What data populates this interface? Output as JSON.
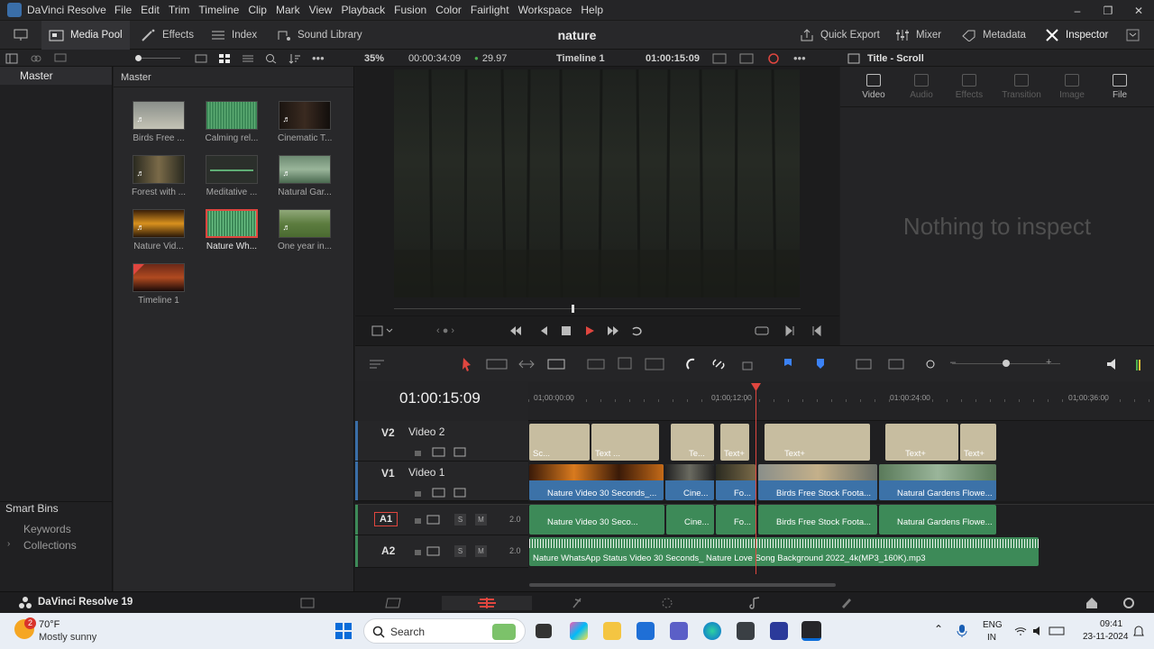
{
  "app": {
    "title": "DaVinci Resolve",
    "menu": [
      "File",
      "Edit",
      "Trim",
      "Timeline",
      "Clip",
      "Mark",
      "View",
      "Playback",
      "Fusion",
      "Color",
      "Fairlight",
      "Workspace",
      "Help"
    ],
    "window_controls": [
      "–",
      "❐",
      "✕"
    ]
  },
  "toolbar": {
    "media_pool": "Media Pool",
    "effects": "Effects",
    "index": "Index",
    "sound_library": "Sound Library",
    "project_name": "nature",
    "quick_export": "Quick Export",
    "mixer": "Mixer",
    "metadata": "Metadata",
    "inspector": "Inspector"
  },
  "viewer_bar": {
    "zoom": "35%",
    "duration": "00:00:34:09",
    "fps": "29.97",
    "timeline_name": "Timeline 1",
    "timecode": "01:00:15:09",
    "inspector_title": "Title - Scroll"
  },
  "bins": {
    "master": "Master",
    "smart_bins": "Smart Bins",
    "keywords": "Keywords",
    "collections": "Collections"
  },
  "media_pool": {
    "header": "Master",
    "clips": [
      {
        "label": "Birds Free ...",
        "kind": "video",
        "selected": false
      },
      {
        "label": "Calming rel...",
        "kind": "audio",
        "selected": false
      },
      {
        "label": "Cinematic T...",
        "kind": "video",
        "selected": false
      },
      {
        "label": "Forest with ...",
        "kind": "video",
        "selected": false
      },
      {
        "label": "Meditative ...",
        "kind": "audio",
        "selected": false
      },
      {
        "label": "Natural Gar...",
        "kind": "video",
        "selected": false
      },
      {
        "label": "Nature Vid...",
        "kind": "video",
        "selected": false
      },
      {
        "label": "Nature Wh...",
        "kind": "audio",
        "selected": true
      },
      {
        "label": "One year in...",
        "kind": "video",
        "selected": false
      },
      {
        "label": "Timeline 1",
        "kind": "timeline",
        "selected": false
      }
    ]
  },
  "inspector": {
    "tabs": [
      "Video",
      "Audio",
      "Effects",
      "Transition",
      "Image",
      "File"
    ],
    "empty_message": "Nothing to inspect"
  },
  "timeline": {
    "timecode": "01:00:15:09",
    "ruler": [
      "01:00:00:00",
      "01:00:12:00",
      "01:00:24:00",
      "01:00:36:00"
    ],
    "tracks": {
      "v2": {
        "id": "V2",
        "name": "Video 2"
      },
      "v1": {
        "id": "V1",
        "name": "Video 1"
      },
      "a1": {
        "id": "A1",
        "level": "2.0",
        "s": "S",
        "m": "M"
      },
      "a2": {
        "id": "A2",
        "level": "2.0",
        "s": "S",
        "m": "M"
      }
    },
    "v2_clips": [
      "Sc...",
      "Text ...",
      "Te...",
      "Text+",
      "Text+",
      "Text+",
      "Text+"
    ],
    "v1_clips": [
      "Nature Video 30 Seconds_...",
      "Cine...",
      "Fo...",
      "Birds Free Stock Foota...",
      "Natural Gardens Flowe..."
    ],
    "a1_clips": [
      "Nature Video 30 Seco...",
      "Cine...",
      "Fo...",
      "Birds Free Stock Foota...",
      "Natural Gardens Flowe..."
    ],
    "a2_clip": "Nature WhatsApp Status Video 30 Seconds_ Nature Love Song Background 2022_4k(MP3_160K).mp3"
  },
  "pagebar": {
    "brand": "DaVinci Resolve 19"
  },
  "taskbar": {
    "weather_temp": "70°F",
    "weather_desc": "Mostly sunny",
    "weather_badge": "2",
    "search": "Search",
    "lang1": "ENG",
    "lang2": "IN",
    "time": "09:41",
    "date": "23-11-2024"
  },
  "colors": {
    "accent_red": "#e0463f",
    "video_clip": "#3c72a8",
    "audio_clip": "#3d8a58",
    "title_clip": "#c7bda0"
  }
}
